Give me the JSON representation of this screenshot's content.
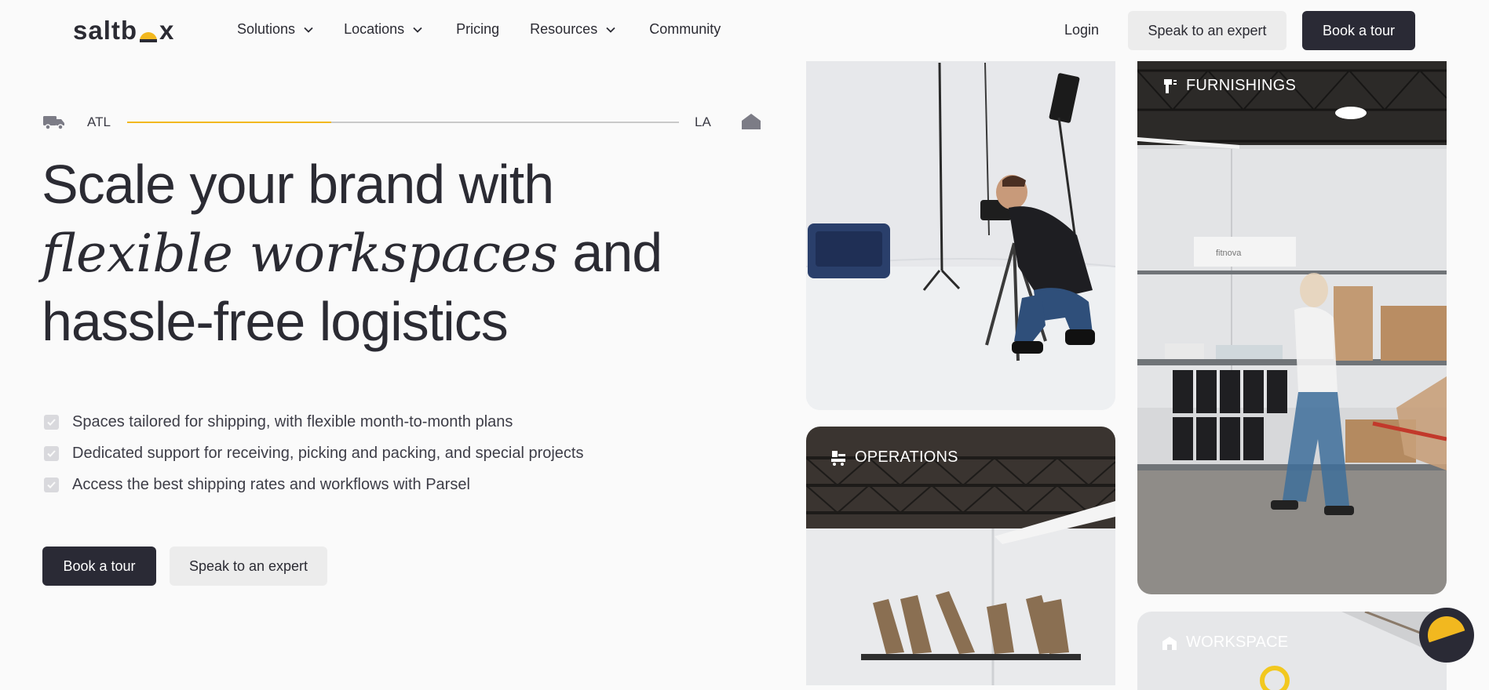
{
  "brand": {
    "logo_text_left": "saltb",
    "logo_text_right": "x"
  },
  "nav": {
    "items": [
      {
        "label": "Solutions",
        "has_dropdown": true
      },
      {
        "label": "Locations",
        "has_dropdown": true
      },
      {
        "label": "Pricing",
        "has_dropdown": false
      },
      {
        "label": "Resources",
        "has_dropdown": true
      },
      {
        "label": "Community",
        "has_dropdown": false
      }
    ],
    "login": "Login",
    "speak_expert": "Speak to an expert",
    "book_tour": "Book a tour"
  },
  "route": {
    "start": "ATL",
    "end": "LA",
    "progress": 0.37
  },
  "hero": {
    "line1": "Scale your brand with",
    "line2_italic": "flexible workspaces",
    "line2_rest": " and",
    "line3": "hassle-free logistics",
    "features": [
      "Spaces tailored for shipping, with flexible month-to-month plans",
      "Dedicated support for receiving, picking and packing, and special projects",
      "Access the best shipping rates and workflows with Parsel"
    ],
    "book_tour": "Book a tour",
    "speak_expert": "Speak to an expert"
  },
  "cards": {
    "operations": "OPERATIONS",
    "furnishings": "FURNISHINGS",
    "workspace": "WORKSPACE",
    "box_text": "fitnova"
  },
  "colors": {
    "accent": "#f2b81f",
    "dark": "#2a2a35",
    "light_button": "#ececec"
  }
}
